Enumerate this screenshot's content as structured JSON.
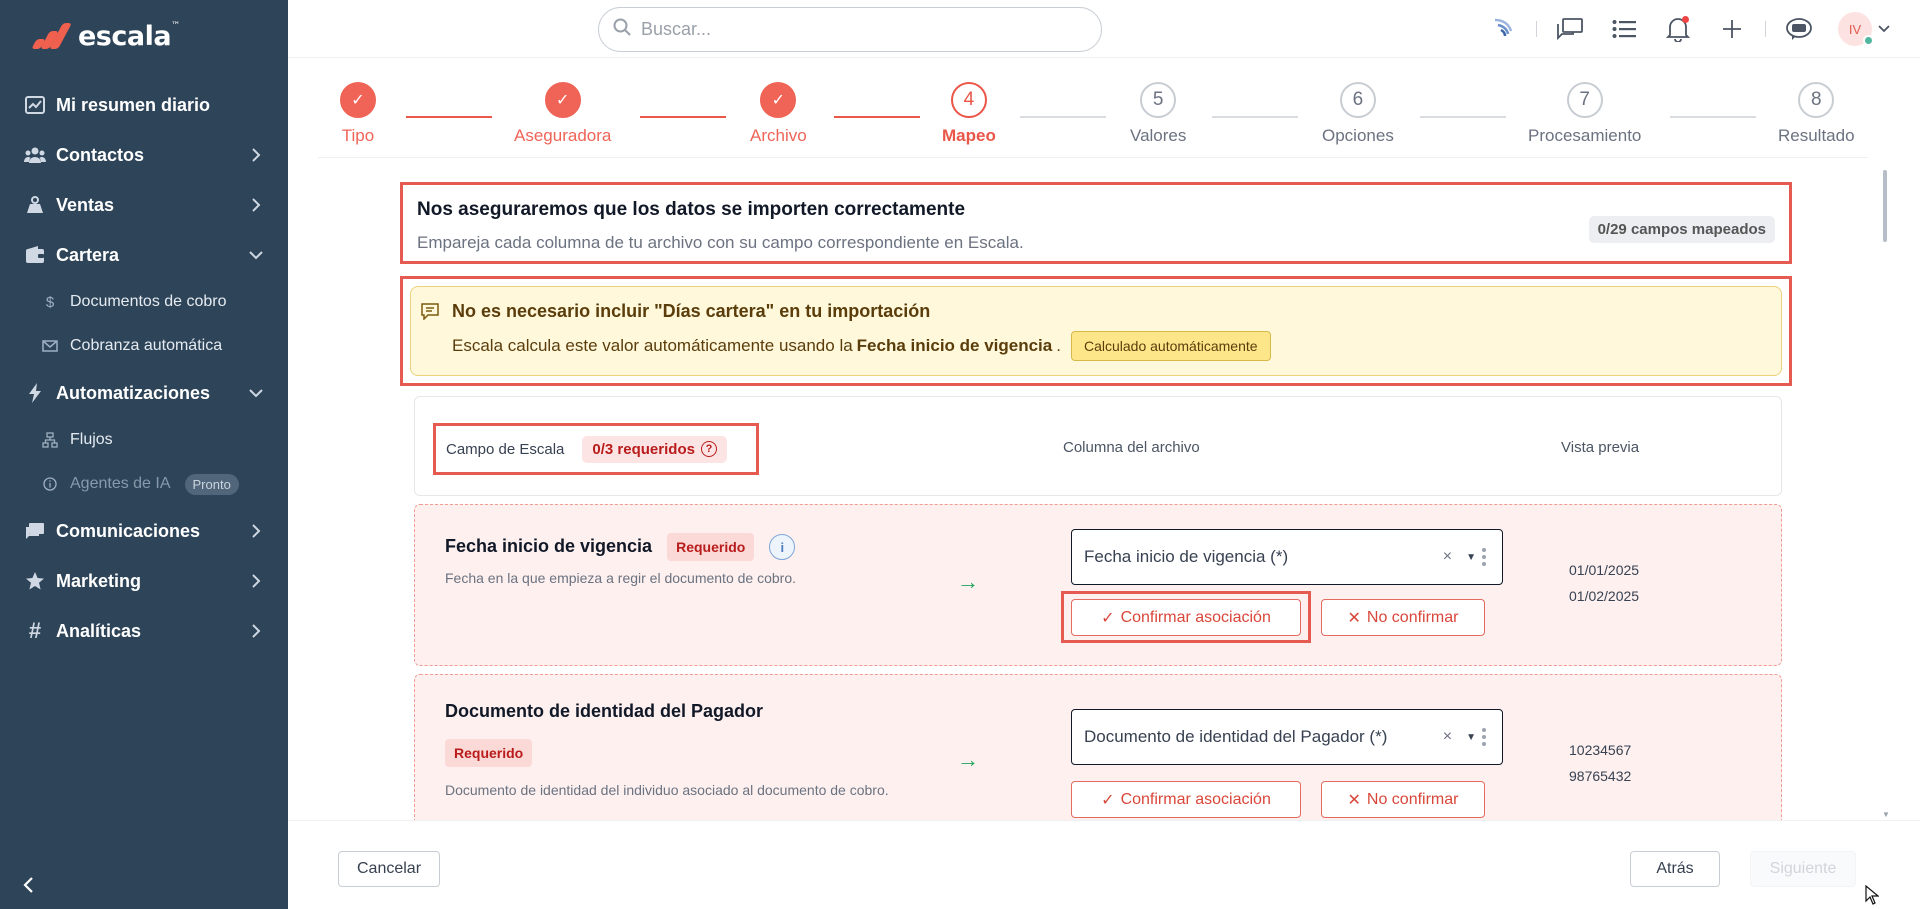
{
  "brand": {
    "name": "escala",
    "tm": "™",
    "color": "#f0604e"
  },
  "sidebar": {
    "items": [
      {
        "label": "Mi resumen diario",
        "icon": "chart-icon",
        "chevron": ""
      },
      {
        "label": "Contactos",
        "icon": "users-icon",
        "chevron": "right"
      },
      {
        "label": "Ventas",
        "icon": "sales-icon",
        "chevron": "right"
      },
      {
        "label": "Cartera",
        "icon": "wallet-icon",
        "chevron": "down",
        "children": [
          {
            "label": "Documentos de cobro",
            "icon": "dollar-icon"
          },
          {
            "label": "Cobranza automática",
            "icon": "mail-icon"
          }
        ]
      },
      {
        "label": "Automatizaciones",
        "icon": "bolt-icon",
        "chevron": "down",
        "children": [
          {
            "label": "Flujos",
            "icon": "flow-icon"
          },
          {
            "label": "Agentes de IA",
            "icon": "info-icon",
            "badge": "Pronto",
            "disabled": true
          }
        ]
      },
      {
        "label": "Comunicaciones",
        "icon": "message-icon",
        "chevron": "right"
      },
      {
        "label": "Marketing",
        "icon": "star-icon",
        "chevron": "right"
      },
      {
        "label": "Analíticas",
        "icon": "hash-icon",
        "chevron": "right"
      }
    ]
  },
  "topbar": {
    "search_placeholder": "Buscar...",
    "avatar_initials": "IV"
  },
  "stepper": {
    "steps": [
      {
        "num": "✓",
        "label": "Tipo",
        "state": "done"
      },
      {
        "num": "✓",
        "label": "Aseguradora",
        "state": "done"
      },
      {
        "num": "✓",
        "label": "Archivo",
        "state": "done"
      },
      {
        "num": "4",
        "label": "Mapeo",
        "state": "active"
      },
      {
        "num": "5",
        "label": "Valores",
        "state": "todo"
      },
      {
        "num": "6",
        "label": "Opciones",
        "state": "todo"
      },
      {
        "num": "7",
        "label": "Procesamiento",
        "state": "todo"
      },
      {
        "num": "8",
        "label": "Resultado",
        "state": "todo"
      }
    ]
  },
  "intro": {
    "title": "Nos aseguraremos que los datos se importen correctamente",
    "subtitle": "Empareja cada columna de tu archivo con su campo correspondiente en Escala.",
    "mapped": "0/29 campos mapeados"
  },
  "notice": {
    "title": "No es necesario incluir \"Días cartera\" en tu importación",
    "text_before": "Escala calcula este valor automáticamente usando la",
    "text_bold": "Fecha inicio de vigencia",
    "text_after": ".",
    "pill": "Calculado automáticamente"
  },
  "table": {
    "col_field": "Campo de Escala",
    "required_count": "0/3 requeridos",
    "help": "?",
    "col_file": "Columna del archivo",
    "col_preview": "Vista previa",
    "rows": [
      {
        "title": "Fecha inicio de vigencia",
        "badge": "Requerido",
        "info": "i",
        "desc": "Fecha en la que empieza a regir el documento de cobro.",
        "select_value": "Fecha inicio de vigencia (*)",
        "clear": "×",
        "confirm": "Confirmar asociación",
        "reject": "No confirmar",
        "preview": [
          "01/01/2025",
          "01/02/2025"
        ]
      },
      {
        "title": "Documento de identidad del Pagador",
        "badge": "Requerido",
        "desc": "Documento de identidad del individuo asociado al documento de cobro.",
        "select_value": "Documento de identidad del Pagador (*)",
        "clear": "×",
        "confirm": "Confirmar asociación",
        "reject": "No confirmar",
        "preview": [
          "10234567",
          "98765432"
        ]
      }
    ]
  },
  "footer": {
    "cancel": "Cancelar",
    "back": "Atrás",
    "next": "Siguiente"
  }
}
